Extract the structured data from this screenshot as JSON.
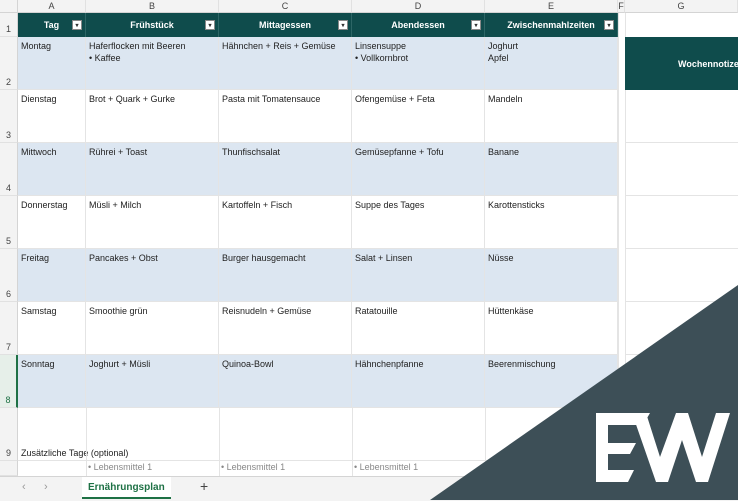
{
  "columns": [
    "A",
    "B",
    "C",
    "D",
    "E",
    "F",
    "G"
  ],
  "header": {
    "tag": "Tag",
    "fruehstueck": "Frühstück",
    "mittagessen": "Mittagessen",
    "abendessen": "Abendessen",
    "zwischen": "Zwischenmahlzeiten"
  },
  "rows": [
    {
      "num": "2",
      "tag": "Montag",
      "b": "Haferflocken mit Beeren\n• Kaffee",
      "c": "Hähnchen + Reis + Gemüse",
      "d": "Linsensuppe\n• Vollkornbrot",
      "e": "Joghurt\nApfel"
    },
    {
      "num": "3",
      "tag": "Dienstag",
      "b": "Brot + Quark + Gurke",
      "c": "Pasta mit Tomatensauce",
      "d": "Ofengemüse + Feta",
      "e": "Mandeln"
    },
    {
      "num": "4",
      "tag": "Mittwoch",
      "b": "Rührei + Toast",
      "c": "Thunfischsalat",
      "d": "Gemüsepfanne + Tofu",
      "e": "Banane"
    },
    {
      "num": "5",
      "tag": "Donnerstag",
      "b": "Müsli + Milch",
      "c": "Kartoffeln + Fisch",
      "d": "Suppe des Tages",
      "e": "Karottensticks"
    },
    {
      "num": "6",
      "tag": "Freitag",
      "b": "Pancakes + Obst",
      "c": "Burger hausgemacht",
      "d": "Salat + Linsen",
      "e": "Nüsse"
    },
    {
      "num": "7",
      "tag": "Samstag",
      "b": "Smoothie grün",
      "c": "Reisnudeln + Gemüse",
      "d": "Ratatouille",
      "e": "Hüttenkäse"
    },
    {
      "num": "8",
      "tag": "Sonntag",
      "b": "Joghurt + Müsli",
      "c": "Quinoa-Bowl",
      "d": "Hähnchenpfanne",
      "e": "Beerenmischung"
    }
  ],
  "row1_num": "1",
  "row9_num": "9",
  "notes_header": "Wochennotizen",
  "extra_title": "Zusätzliche Tage (optional)",
  "extra_items": [
    "• Lebensmittel 1",
    "• Lebensmittel 1",
    "• Lebensmittel 1"
  ],
  "tab": {
    "active": "Ernährungsplan",
    "add": "+",
    "prev": "‹",
    "next": "›"
  },
  "colors": {
    "header_bg": "#0f4c4c",
    "band": "#dce6f1",
    "accent": "#1e7145",
    "overlay": "#3d4f57"
  },
  "overlay_logo": "EW"
}
